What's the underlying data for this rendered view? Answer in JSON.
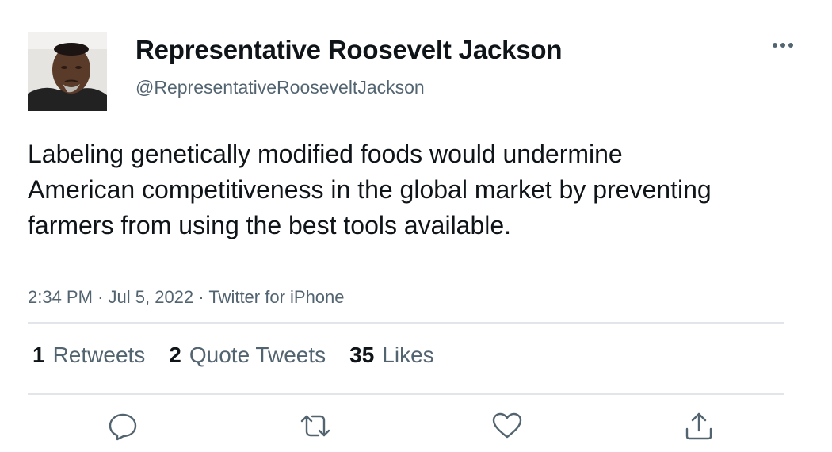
{
  "tweet": {
    "display_name": "Representative Roosevelt Jackson",
    "handle": "@RepresentativeRooseveltJackson",
    "text": "Labeling genetically modified foods would undermine American competitiveness in the global market by preventing farmers from using the best tools available.",
    "time": "2:34 PM",
    "date": "Jul 5, 2022",
    "source": "Twitter for iPhone",
    "separator": "·"
  },
  "stats": {
    "retweets_count": "1",
    "retweets_label": "Retweets",
    "quotes_count": "2",
    "quotes_label": "Quote Tweets",
    "likes_count": "35",
    "likes_label": "Likes"
  },
  "icons": {
    "more": "more-icon",
    "reply": "reply-icon",
    "retweet": "retweet-icon",
    "like": "heart-icon",
    "share": "share-icon"
  },
  "colors": {
    "text_primary": "#0f1419",
    "text_secondary": "#536471",
    "divider": "#e2e6ea",
    "icon": "#536471"
  }
}
